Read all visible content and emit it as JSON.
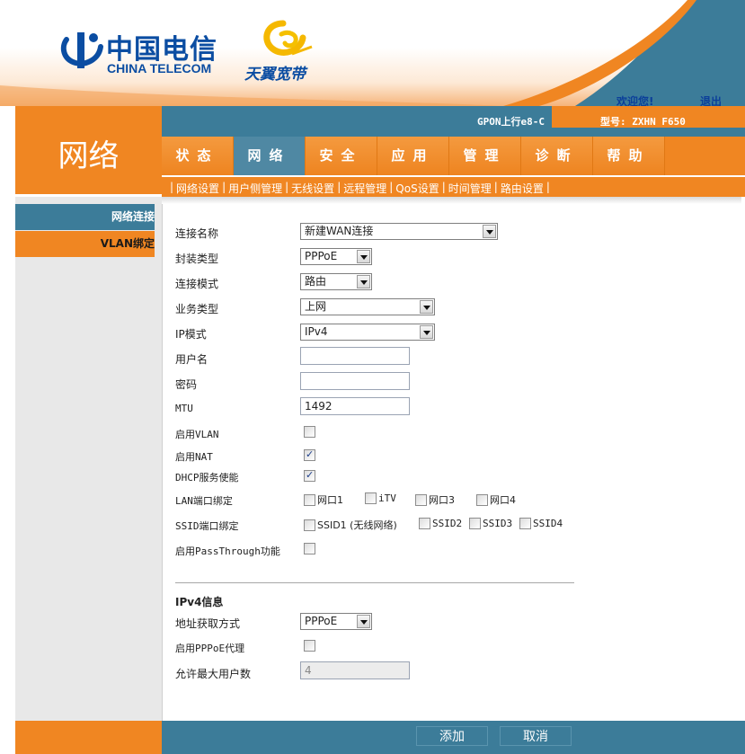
{
  "header": {
    "brand_cn": "中国电信",
    "brand_en": "CHINA TELECOM",
    "sub_brand": "天翼宽带",
    "welcome": "欢迎您!",
    "logout": "退出"
  },
  "section_title": "网络",
  "infobar": {
    "uplink": "GPON上行e8-C",
    "model": "型号: ZXHN F650"
  },
  "tabs": [
    {
      "label": "状态",
      "active": false
    },
    {
      "label": "网络",
      "active": true
    },
    {
      "label": "安全",
      "active": false
    },
    {
      "label": "应用",
      "active": false
    },
    {
      "label": "管理",
      "active": false
    },
    {
      "label": "诊断",
      "active": false
    },
    {
      "label": "帮助",
      "active": false
    }
  ],
  "subnav": [
    "网络设置",
    "用户侧管理",
    "无线设置",
    "远程管理",
    "QoS设置",
    "时间管理",
    "路由设置"
  ],
  "sidebar": {
    "items": [
      "网络连接",
      "VLAN绑定"
    ]
  },
  "form": {
    "labels": {
      "conn_name": "连接名称",
      "encap": "封装类型",
      "conn_mode": "连接模式",
      "service": "业务类型",
      "ip_mode": "IP模式",
      "username": "用户名",
      "password": "密码",
      "mtu": "MTU",
      "enable_vlan": "启用VLAN",
      "enable_nat": "启用NAT",
      "dhcp": "DHCP服务使能",
      "lan_bind": "LAN端口绑定",
      "ssid_bind": "SSID端口绑定",
      "passthrough": "启用PassThrough功能"
    },
    "values": {
      "conn_name": "新建WAN连接",
      "encap": "PPPoE",
      "conn_mode": "路由",
      "service": "上网",
      "ip_mode": "IPv4",
      "username": "",
      "password": "",
      "mtu": "1492"
    },
    "checks": {
      "enable_vlan": false,
      "enable_nat": true,
      "dhcp": true,
      "passthrough": false
    },
    "lan_ports": [
      "网口1",
      "iTV",
      "网口3",
      "网口4"
    ],
    "ssid_ports": [
      "SSID1 (无线网络)",
      "SSID2",
      "SSID3",
      "SSID4"
    ]
  },
  "ipv4": {
    "title": "IPv4信息",
    "labels": {
      "addr_mode": "地址获取方式",
      "pppoe_proxy": "启用PPPoE代理",
      "max_users": "允许最大用户数"
    },
    "values": {
      "addr_mode": "PPPoE",
      "max_users": "4"
    },
    "checks": {
      "pppoe_proxy": false
    }
  },
  "footer": {
    "add": "添加",
    "cancel": "取消"
  },
  "colors": {
    "orange": "#f08622",
    "blue": "#3c7c99",
    "active_tab": "#4f88a3",
    "brand_blue": "#0b4da2"
  }
}
